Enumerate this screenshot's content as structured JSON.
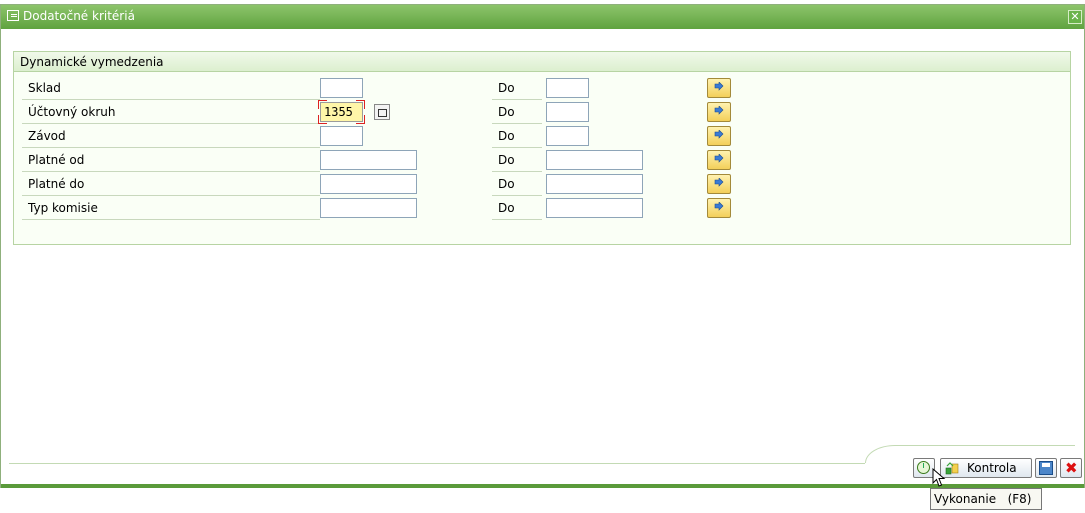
{
  "window": {
    "title": "Dodatočné kritériá",
    "close_label": "✕"
  },
  "group": {
    "title": "Dynamické vymedzenia"
  },
  "rows": [
    {
      "label": "Sklad",
      "from": "",
      "to_label": "Do",
      "to": ""
    },
    {
      "label": "Účtovný okruh",
      "from": "1355",
      "to_label": "Do",
      "to": ""
    },
    {
      "label": "Závod",
      "from": "",
      "to_label": "Do",
      "to": ""
    },
    {
      "label": "Platné od",
      "from": "",
      "to_label": "Do",
      "to": ""
    },
    {
      "label": "Platné do",
      "from": "",
      "to_label": "Do",
      "to": ""
    },
    {
      "label": "Typ komisie",
      "from": "",
      "to_label": "Do",
      "to": ""
    }
  ],
  "footer": {
    "kontrola_label": "Kontrola"
  },
  "tooltip": {
    "text": "Vykonanie   (F8)"
  },
  "colors": {
    "title_bar": "#5fa33f",
    "active_field": "#fff6a8",
    "multiselect_button": "#f3cf5a"
  },
  "icons": {
    "title": "dialog-icon",
    "execute": "clock-execute-icon",
    "check": "check-icon",
    "save": "save-icon",
    "cancel": "cancel-icon",
    "multiselect": "multiple-selection-arrow-icon"
  }
}
